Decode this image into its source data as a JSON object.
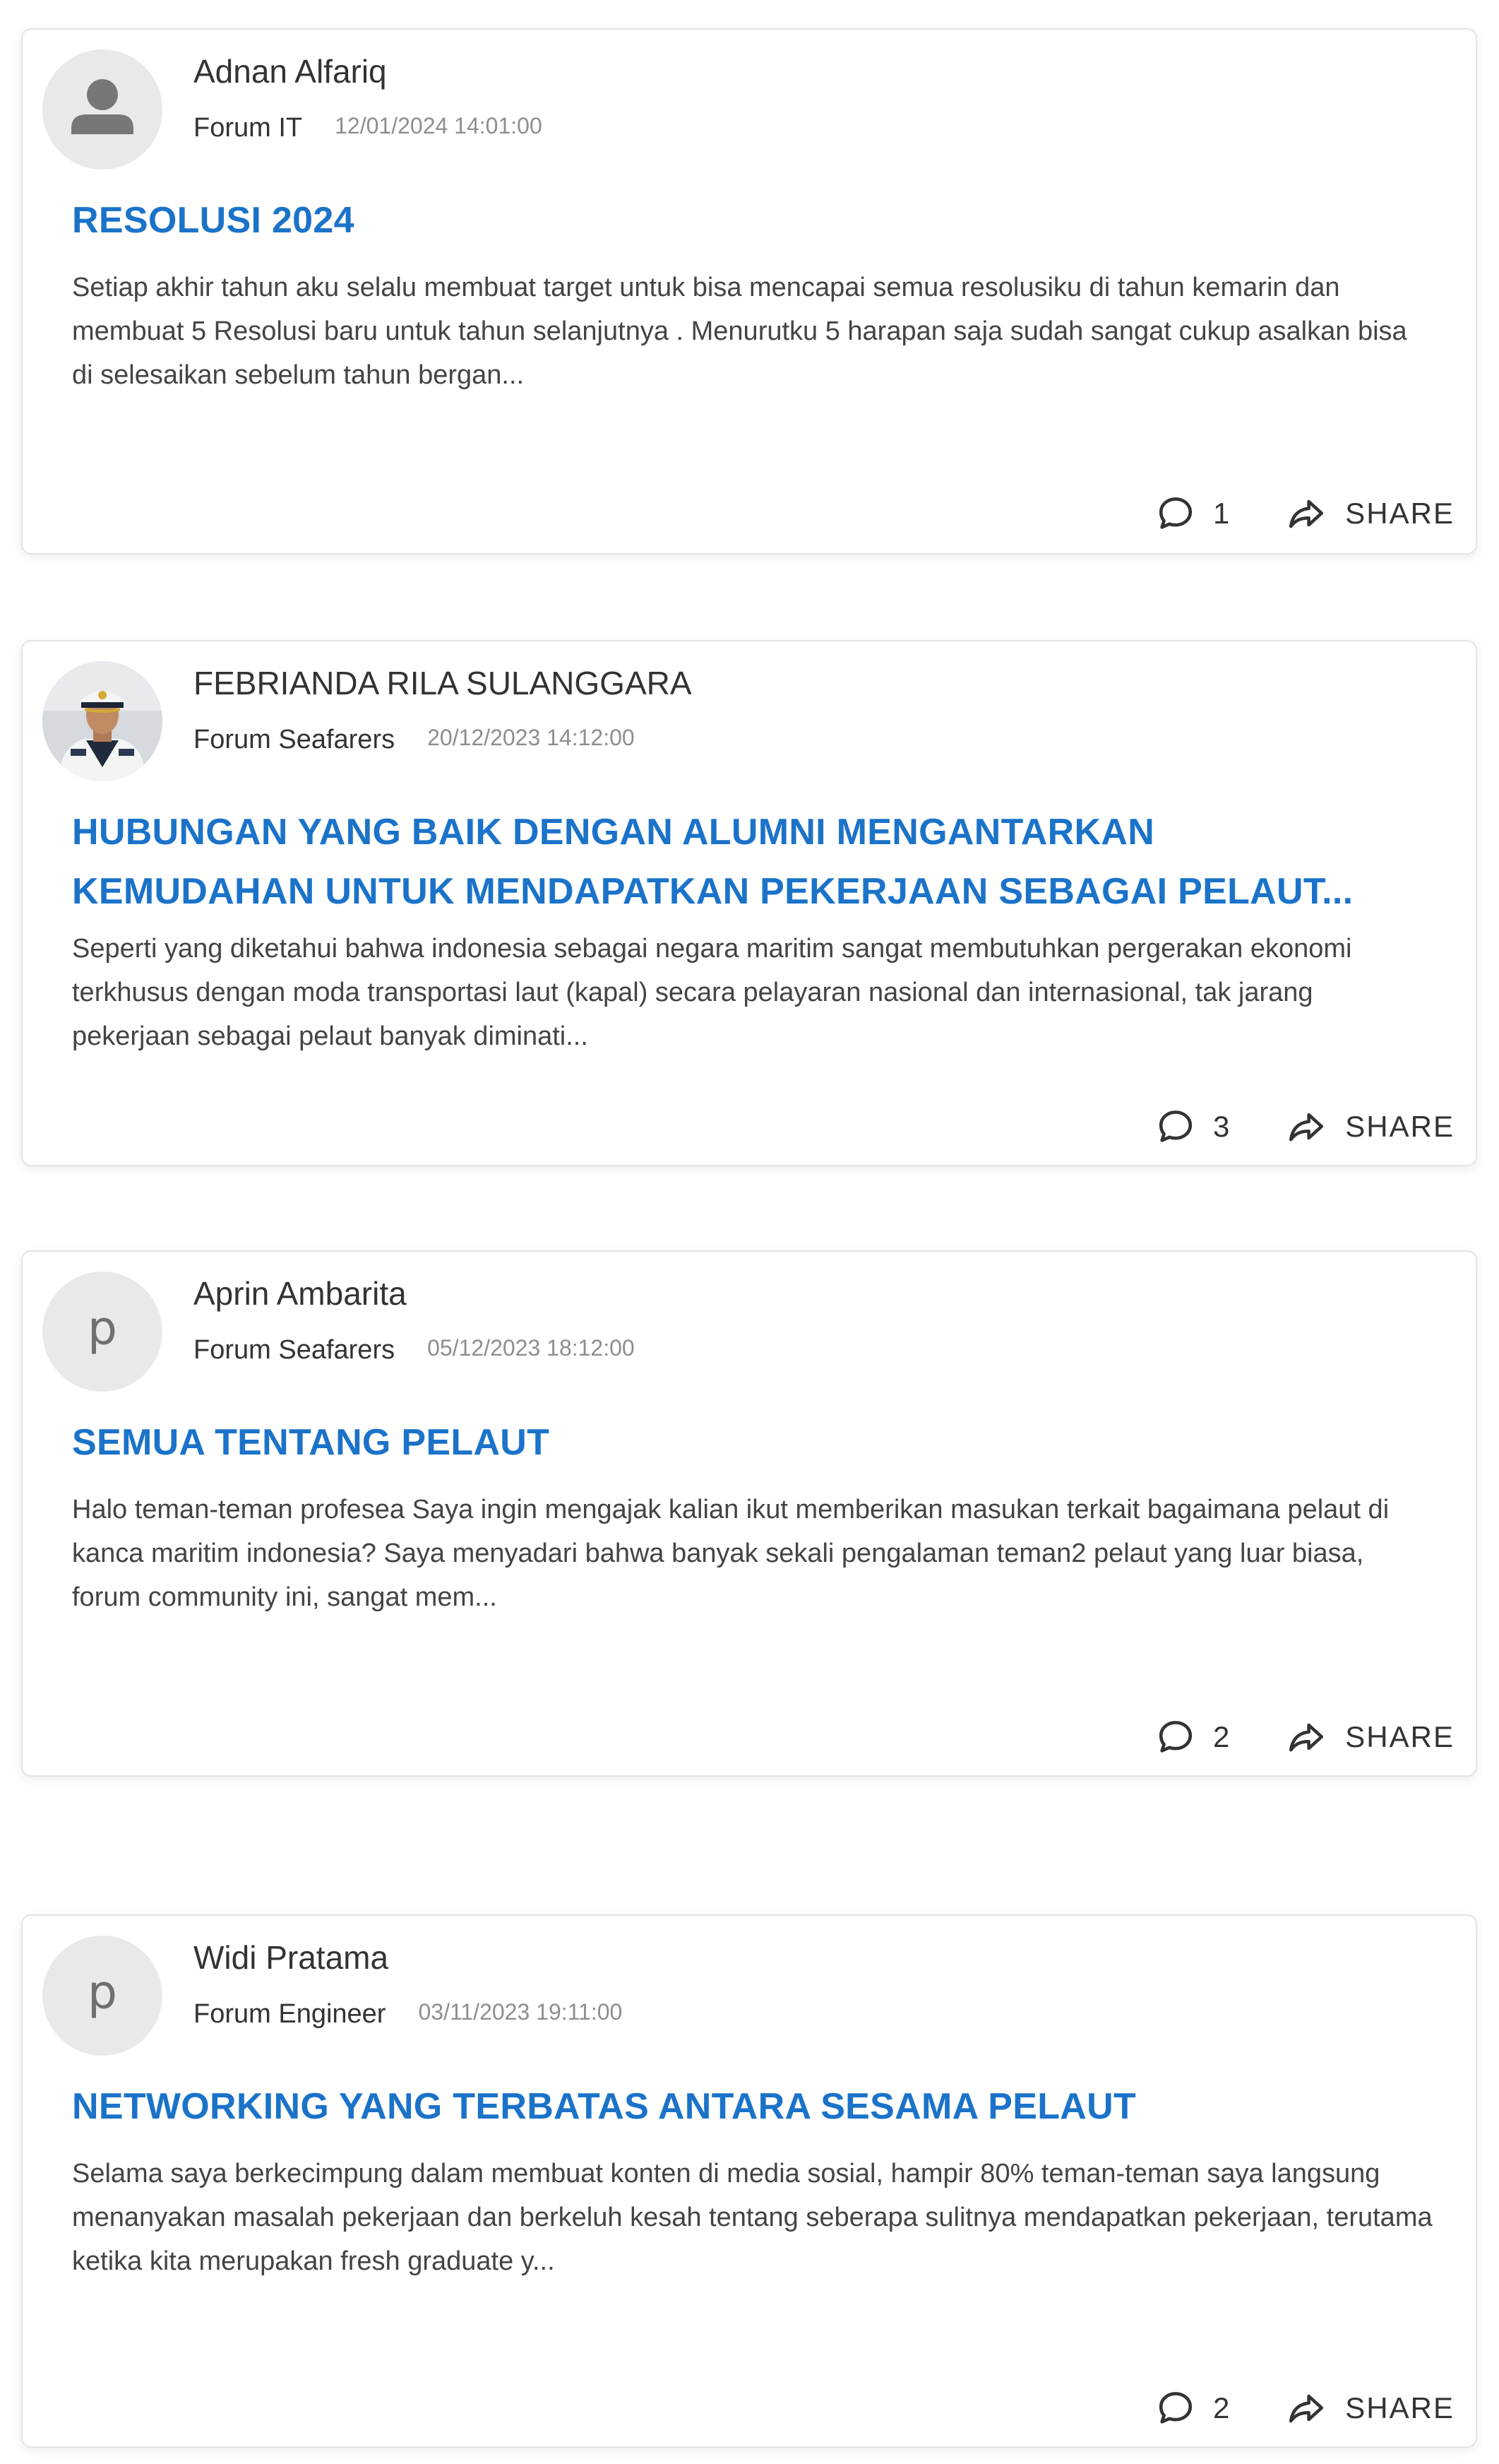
{
  "posts": [
    {
      "author": "Adnan Alfariq",
      "forum": "Forum IT",
      "date": "12/01/2024 14:01:00",
      "avatar_icon": "person-silhouette-icon",
      "avatar_letter": "",
      "title": "RESOLUSI 2024",
      "excerpt": "Setiap akhir tahun aku selalu membuat target untuk bisa mencapai semua resolusiku di tahun kemarin dan membuat 5 Resolusi baru untuk tahun selanjutnya . Menurutku 5 harapan saja sudah sangat cukup asalkan bisa di selesaikan sebelum tahun bergan...",
      "comments": "1",
      "share_label": "SHARE"
    },
    {
      "author": "FEBRIANDA RILA SULANGGARA",
      "forum": "Forum Seafarers",
      "date": "20/12/2023 14:12:00",
      "avatar_icon": "profile-photo",
      "avatar_letter": "",
      "title": "HUBUNGAN YANG BAIK DENGAN ALUMNI MENGANTARKAN KEMUDAHAN UNTUK MENDAPATKAN PEKERJAAN SEBAGAI PELAUT...",
      "excerpt": "Seperti yang diketahui bahwa indonesia sebagai negara maritim sangat membutuhkan pergerakan ekonomi terkhusus dengan moda transportasi laut (kapal) secara pelayaran nasional dan internasional, tak jarang pekerjaan sebagai pelaut banyak diminati...",
      "comments": "3",
      "share_label": "SHARE"
    },
    {
      "author": "Aprin Ambarita",
      "forum": "Forum Seafarers",
      "date": "05/12/2023 18:12:00",
      "avatar_icon": "letter-avatar",
      "avatar_letter": "p",
      "title": "SEMUA TENTANG PELAUT",
      "excerpt": "Halo teman-teman profesea  Saya ingin mengajak kalian ikut memberikan masukan terkait bagaimana pelaut di kanca maritim indonesia? Saya menyadari bahwa banyak sekali pengalaman teman2 pelaut yang luar biasa, forum community ini, sangat mem...",
      "comments": "2",
      "share_label": "SHARE"
    },
    {
      "author": "Widi Pratama",
      "forum": "Forum Engineer",
      "date": "03/11/2023 19:11:00",
      "avatar_icon": "letter-avatar",
      "avatar_letter": "p",
      "title": "NETWORKING YANG TERBATAS ANTARA SESAMA PELAUT",
      "excerpt": "Selama saya berkecimpung dalam membuat konten di media sosial, hampir 80% teman-teman saya langsung menanyakan masalah pekerjaan dan berkeluh kesah tentang seberapa sulitnya mendapatkan pekerjaan, terutama ketika kita merupakan fresh graduate y...",
      "comments": "2",
      "share_label": "SHARE"
    }
  ],
  "icons": {
    "comment": "comment-bubble-icon",
    "share": "share-arrow-icon"
  },
  "colors": {
    "title": "#1b73c9",
    "date": "#8e8e8e",
    "text": "#333333",
    "avatar_bg": "#e9e9e9"
  }
}
